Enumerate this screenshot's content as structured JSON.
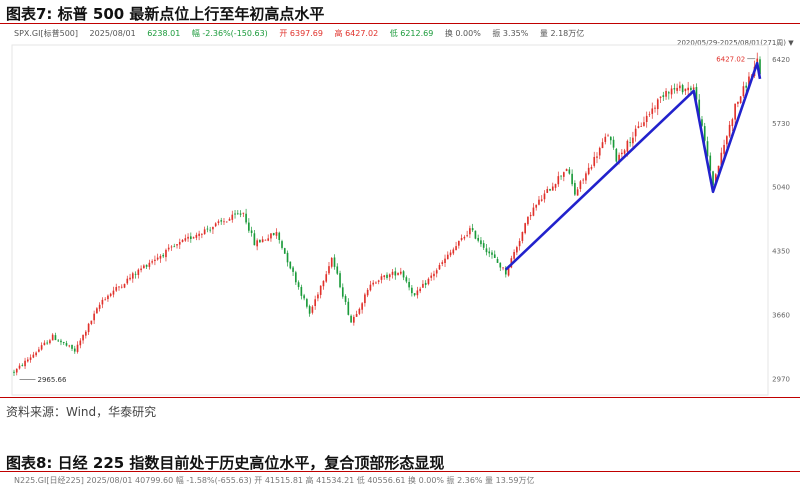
{
  "figure7": {
    "title": "图表7:  标普 500 最新点位上行至年初高点水平",
    "info": {
      "symbol": "SPX.GI[标普500]",
      "date": "2025/08/01",
      "close": "6238.01",
      "change": "幅 -2.36%(-150.63)",
      "open": "开 6397.69",
      "high": "高 6427.02",
      "low": "低 6212.69",
      "turnover_rate": "换 0.00%",
      "amplitude": "振 3.35%",
      "volume": "量 2.18万亿"
    },
    "range_label": "2020/05/29-2025/08/01(271周)",
    "source": "资料来源：Wind，华泰研究"
  },
  "figure8": {
    "title": "图表8:  日经 225 指数目前处于历史高位水平，复合顶部形态显现",
    "info_line": "N225.GI[日经225]   2025/08/01   40799.60   幅 -1.58%(-655.63)   开 41515.81   高 41534.21   低 40556.61   换 0.00%   振 2.36%   量 13.59万亿"
  },
  "colors": {
    "up": "#e0302a",
    "down": "#1a9a3a",
    "trendline": "#2222cc",
    "rule": "#c00000"
  },
  "chart_data": {
    "type": "candlestick",
    "series_name": "SPX.GI[标普500]",
    "x_range": [
      "2020/05/29",
      "2025/08/01"
    ],
    "y_ticks": [
      2970,
      3660,
      4350,
      5040,
      5730,
      6420
    ],
    "ylim": [
      2850,
      6500
    ],
    "min_label": "2965.66",
    "max_label": "6427.02",
    "grid": false,
    "legend": "none",
    "waypoints": [
      [
        "2020/05/29",
        3044
      ],
      [
        "2020/09/04",
        3426
      ],
      [
        "2020/10/30",
        3270
      ],
      [
        "2021/01/08",
        3824
      ],
      [
        "2021/05/07",
        4232
      ],
      [
        "2021/09/03",
        4535
      ],
      [
        "2021/12/31",
        4766
      ],
      [
        "2022/01/28",
        4431
      ],
      [
        "2022/03/25",
        4543
      ],
      [
        "2022/06/17",
        3675
      ],
      [
        "2022/08/12",
        4280
      ],
      [
        "2022/09/30",
        3586
      ],
      [
        "2022/11/25",
        4026
      ],
      [
        "2023/02/03",
        4136
      ],
      [
        "2023/03/10",
        3862
      ],
      [
        "2023/07/28",
        4582
      ],
      [
        "2023/10/27",
        4117
      ],
      [
        "2023/12/29",
        4770
      ],
      [
        "2024/03/29",
        5254
      ],
      [
        "2024/04/19",
        4967
      ],
      [
        "2024/07/12",
        5615
      ],
      [
        "2024/08/02",
        5346
      ],
      [
        "2024/12/06",
        6090
      ],
      [
        "2025/02/14",
        6114
      ],
      [
        "2025/04/04",
        5074
      ],
      [
        "2025/05/30",
        5912
      ],
      [
        "2025/07/25",
        6389
      ],
      [
        "2025/08/01",
        6238
      ]
    ],
    "annotation_lines": [
      [
        [
          "2023/10/27",
          4150
        ],
        [
          "2025/02/14",
          6080
        ],
        [
          "2025/04/04",
          4990
        ],
        [
          "2025/07/25",
          6380
        ],
        [
          "2025/08/01",
          6210
        ]
      ]
    ]
  }
}
